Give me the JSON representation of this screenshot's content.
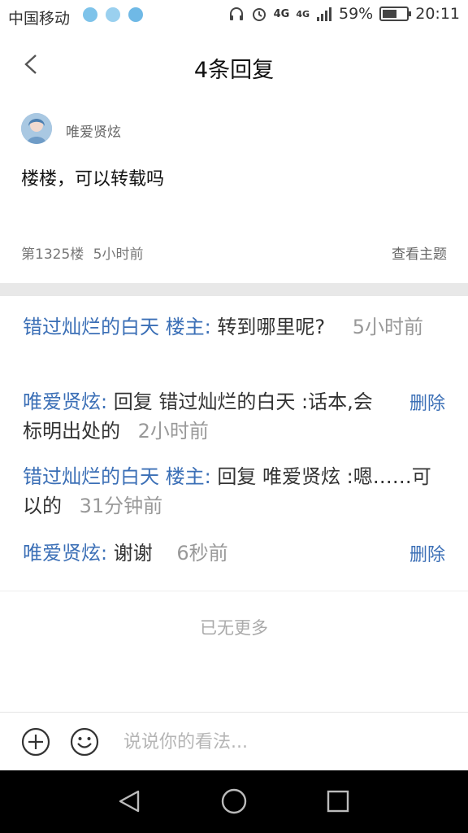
{
  "status_bar": {
    "carrier": "中国移动",
    "network_a": "4G",
    "network_b": "4G",
    "battery_text": "59%",
    "battery_level": 0.59,
    "time": "20:11"
  },
  "header": {
    "title": "4条回复",
    "back_icon": "chevron-left-icon"
  },
  "post": {
    "author": "唯爱贤炫",
    "content": "楼楼，可以转载吗",
    "floor": "第1325楼",
    "time": "5小时前",
    "view_topic": "查看主题"
  },
  "replies": [
    {
      "user": "错过灿烂的白天 楼主:",
      "text": "转到哪里呢?",
      "time": "5小时前",
      "can_delete": false
    },
    {
      "user": "唯爱贤炫:",
      "text": "回复 错过灿烂的白天 :话本,会标明出处的",
      "time": "2小时前",
      "can_delete": true
    },
    {
      "user": "错过灿烂的白天 楼主:",
      "text": "回复 唯爱贤炫 :嗯……可以的",
      "time": "31分钟前",
      "can_delete": false
    },
    {
      "user": "唯爱贤炫:",
      "text": "谢谢",
      "time": "6秒前",
      "can_delete": true
    }
  ],
  "delete_label": "删除",
  "no_more": "已无更多",
  "input_bar": {
    "placeholder": "说说你的看法...",
    "add_icon": "plus-circle-icon",
    "emoji_icon": "smiley-icon"
  },
  "colors": {
    "link_blue": "#3b6fb6",
    "divider_gray": "#e8e8e8"
  }
}
